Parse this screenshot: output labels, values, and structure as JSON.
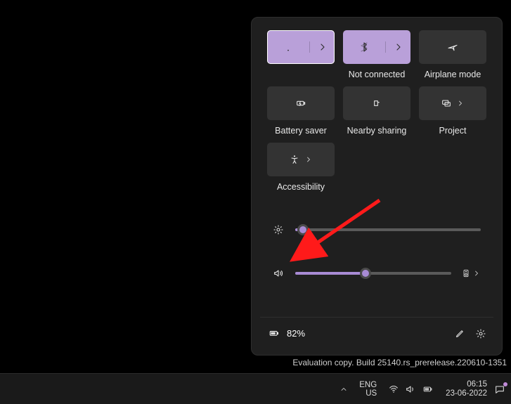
{
  "tiles": {
    "wifi": {
      "label": "",
      "active": true,
      "focused": true
    },
    "bluetooth": {
      "label": "Not connected",
      "active": true
    },
    "airplane": {
      "label": "Airplane mode",
      "active": false
    },
    "battery_saver": {
      "label": "Battery saver",
      "active": false
    },
    "nearby": {
      "label": "Nearby sharing",
      "active": false
    },
    "project": {
      "label": "Project",
      "active": false
    },
    "accessibility": {
      "label": "Accessibility",
      "active": false
    }
  },
  "sliders": {
    "brightness": {
      "value_pct": 4
    },
    "volume": {
      "value_pct": 45
    }
  },
  "footer": {
    "battery_text": "82%"
  },
  "watermark": "Evaluation copy. Build 25140.rs_prerelease.220610-1351",
  "taskbar": {
    "lang_line1": "ENG",
    "lang_line2": "US",
    "time": "06:15",
    "date": "23-06-2022"
  },
  "annotation": {
    "arrow_color": "#ff1a1a"
  }
}
